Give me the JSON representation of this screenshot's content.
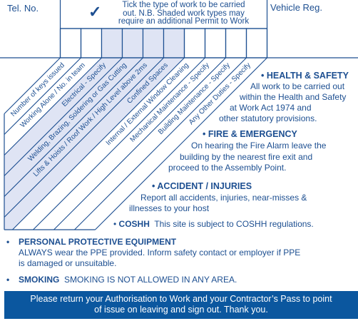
{
  "header": {
    "tel_label": "Tel. No.",
    "vehicle_label": "Vehicle Reg.",
    "tick_symbol": "✓",
    "instructions": [
      "Tick the type of work to be carried",
      "out. N.B. Shaded work types may",
      "require an additional Permit to Work"
    ]
  },
  "work_types": [
    {
      "label": "Number of keys issued",
      "shaded": false
    },
    {
      "label": "Working Alone / No. in team",
      "shaded": false
    },
    {
      "label": "Electrical - Specify",
      "shaded": true
    },
    {
      "label": "Welding, Brazing, Soldering or Gas Cutting",
      "shaded": true
    },
    {
      "label": "Lifts & Hoists / Roof Work / High Level above 2ms",
      "shaded": true
    },
    {
      "label": "Confined Spaces",
      "shaded": true
    },
    {
      "label": "Internal / External Window Cleaning",
      "shaded": false
    },
    {
      "label": "Mechanical Maintenance - Specify",
      "shaded": false
    },
    {
      "label": "Building Maintenance - Specify",
      "shaded": false
    },
    {
      "label": "Any Other Duties - Specify",
      "shaded": false
    }
  ],
  "sections": {
    "health_safety": {
      "title": "HEALTH & SAFETY",
      "lines": [
        "All work to be carried out",
        "within the Health and Safety",
        "at Work Act 1974 and",
        "other statutory provisions."
      ]
    },
    "fire": {
      "title": "FIRE & EMERGENCY",
      "lines": [
        "On hearing the Fire Alarm leave the",
        "building by the nearest fire exit and",
        "proceed to the Assembly Point."
      ]
    },
    "accident": {
      "title": "ACCIDENT / INJURIES",
      "lines": [
        "Report all accidents, injuries, near-misses &",
        "illnesses to your host"
      ]
    },
    "coshh": {
      "title": "COSHH",
      "text": "This site is subject to COSHH regulations."
    },
    "ppe": {
      "title": "PERSONAL PROTECTIVE EQUIPMENT",
      "lines": [
        "ALWAYS wear the PPE provided. Inform safety contact or employer if PPE",
        "is damaged or unsuitable."
      ]
    },
    "smoking": {
      "title": "SMOKING",
      "text": "SMOKING IS NOT ALLOWED IN ANY AREA."
    }
  },
  "banner": {
    "lines": [
      "Please return your Authorisation to Work and your Contractor’s Pass to point",
      "of issue on leaving and sign out. Thank you."
    ]
  },
  "colors": {
    "ink": "#1d4f91",
    "shade": "#dfe4f4",
    "banner": "#0b579f"
  }
}
